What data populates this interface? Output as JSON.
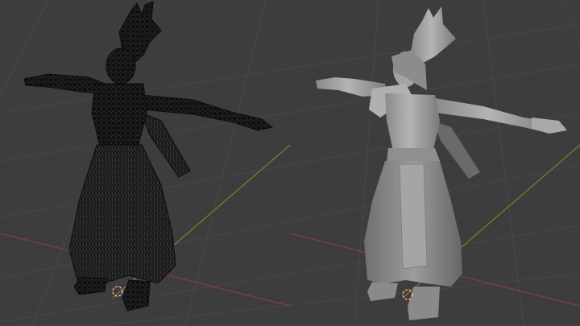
{
  "viewport": {
    "background": "#3d3d3d",
    "grid_color": "#474747",
    "x_axis_color": "#8b3a44",
    "y_axis_color": "#6a8a2a"
  },
  "views": [
    {
      "mode": "wireframe",
      "mesh_color": "#0c0c0c"
    },
    {
      "mode": "solid",
      "mesh_color": "#9a9a9a"
    }
  ],
  "icons": {
    "origin": "3d-cursor-icon"
  }
}
